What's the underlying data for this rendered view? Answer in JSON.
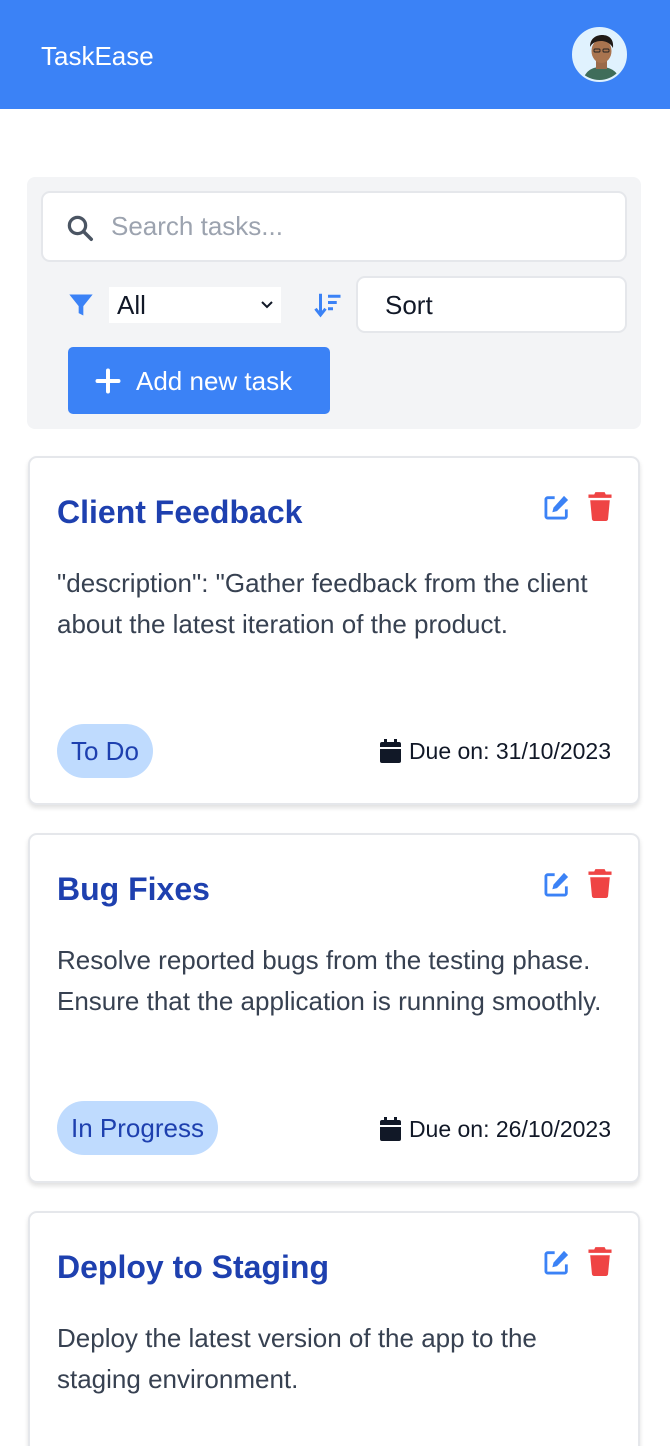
{
  "app": {
    "title": "TaskEase"
  },
  "search": {
    "placeholder": "Search tasks...",
    "value": ""
  },
  "filter": {
    "selected": "All"
  },
  "sort": {
    "label": "Sort"
  },
  "add_button": {
    "label": "Add new task"
  },
  "colors": {
    "primary": "#3b82f6",
    "title": "#1e40af",
    "danger": "#ef4444",
    "badge_bg": "#bfdbfe"
  },
  "tasks": [
    {
      "title": "Client Feedback",
      "description": "\"description\": \"Gather feedback from the client about the latest iteration of the product.",
      "status": "To Do",
      "due": "Due on: 31/10/2023"
    },
    {
      "title": "Bug Fixes",
      "description": "Resolve reported bugs from the testing phase. Ensure that the application is running smoothly.",
      "status": "In Progress",
      "due": "Due on: 26/10/2023"
    },
    {
      "title": "Deploy to Staging",
      "description": "Deploy the latest version of the app to the staging environment.",
      "status": "",
      "due": ""
    }
  ]
}
